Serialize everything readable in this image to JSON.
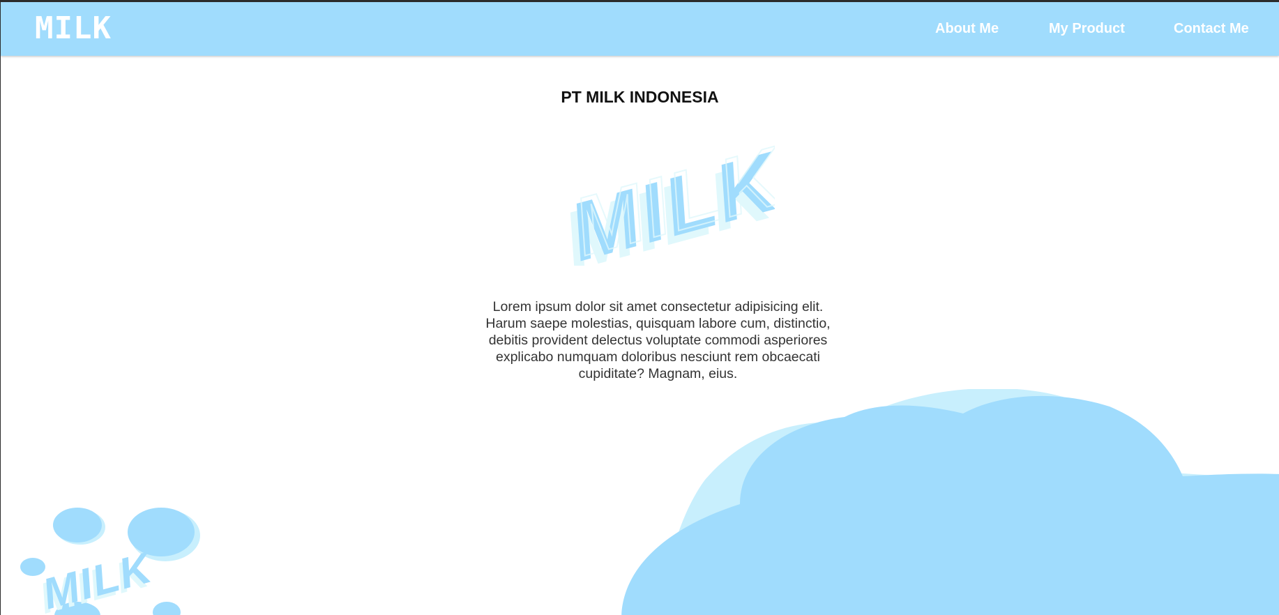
{
  "navbar": {
    "brand": "MILK",
    "links": [
      {
        "label": "About Me"
      },
      {
        "label": "My Product"
      },
      {
        "label": "Contact Me"
      }
    ]
  },
  "main": {
    "title": "PT MILK INDONESIA",
    "logo_text": "MILK",
    "intro": "Lorem ipsum dolor sit amet consectetur adipisicing elit. Harum saepe molestias, quisquam labore cum, distinctio, debitis provident delectus voluptate commodi asperiores explicabo numquam doloribus nesciunt rem obcaecati cupiditate? Magnam, eius."
  },
  "decor": {
    "bubbles_text": "MILK"
  },
  "colors": {
    "accent": "#a0dcfd",
    "accent_light": "#c8effd",
    "accent_pale": "#e0f8fc",
    "text_dark": "#111111",
    "text_body": "#333333"
  }
}
